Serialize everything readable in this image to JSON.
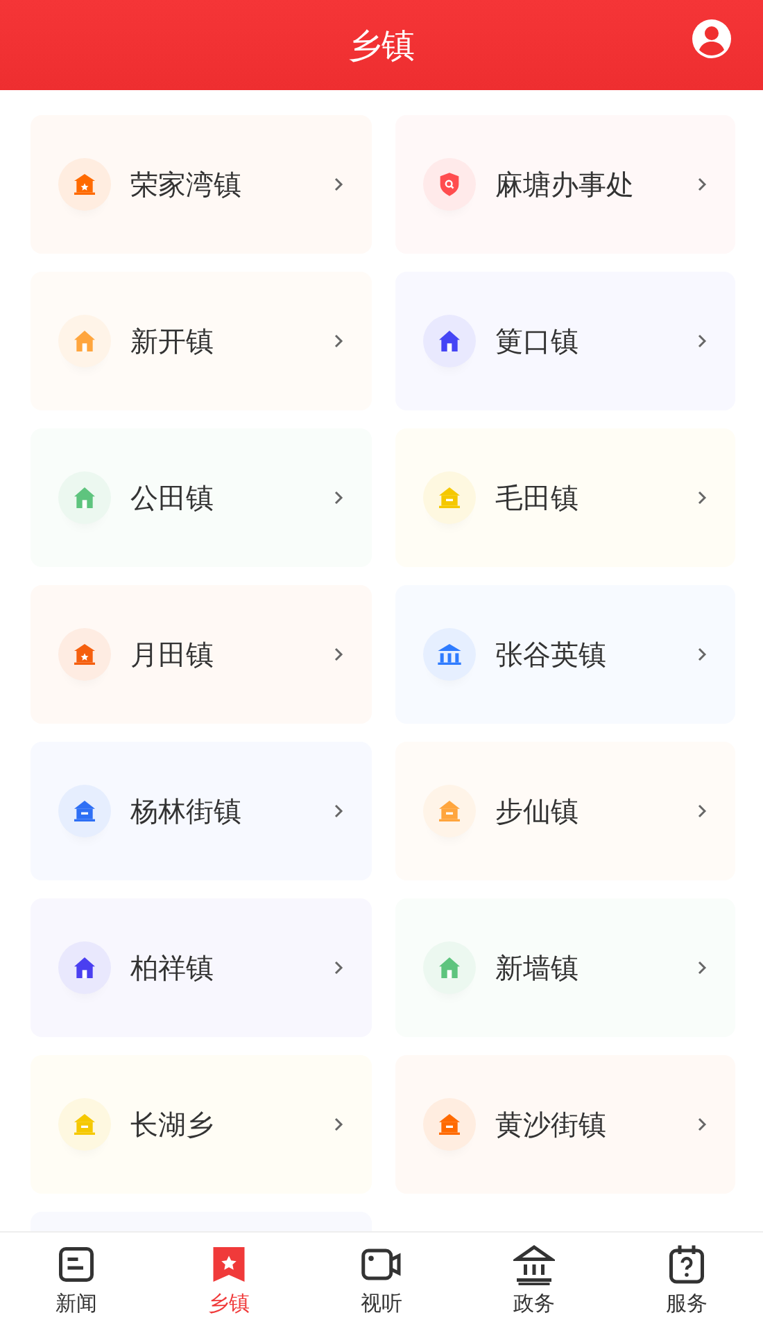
{
  "header": {
    "title": "乡镇"
  },
  "towns": [
    {
      "name": "荣家湾镇",
      "kind": "star-hall",
      "color": "#ff6a00"
    },
    {
      "name": "麻塘办事处",
      "kind": "shield",
      "color": "#ff4d4f"
    },
    {
      "name": "新开镇",
      "kind": "house",
      "color": "#ffa53d"
    },
    {
      "name": "筻口镇",
      "kind": "house",
      "color": "#4545f5"
    },
    {
      "name": "公田镇",
      "kind": "house",
      "color": "#5ec47e"
    },
    {
      "name": "毛田镇",
      "kind": "shop",
      "color": "#f5c800"
    },
    {
      "name": "月田镇",
      "kind": "star-hall",
      "color": "#f55f0e"
    },
    {
      "name": "张谷英镇",
      "kind": "bank",
      "color": "#2e7bff"
    },
    {
      "name": "杨林街镇",
      "kind": "shop",
      "color": "#2e6ff5"
    },
    {
      "name": "步仙镇",
      "kind": "shop",
      "color": "#ffa53d"
    },
    {
      "name": "柏祥镇",
      "kind": "house",
      "color": "#4a3ff0"
    },
    {
      "name": "新墙镇",
      "kind": "house",
      "color": "#5ec47e"
    },
    {
      "name": "长湖乡",
      "kind": "shop",
      "color": "#f5c800"
    },
    {
      "name": "黄沙街镇",
      "kind": "shop",
      "color": "#ff6a00"
    },
    {
      "kind": "blank"
    }
  ],
  "tabbar": [
    {
      "label": "新闻",
      "kind": "news",
      "selected": false
    },
    {
      "label": "乡镇",
      "kind": "town",
      "selected": true
    },
    {
      "label": "视听",
      "kind": "video",
      "selected": false
    },
    {
      "label": "政务",
      "kind": "gov",
      "selected": false
    },
    {
      "label": "服务",
      "kind": "service",
      "selected": false
    }
  ]
}
